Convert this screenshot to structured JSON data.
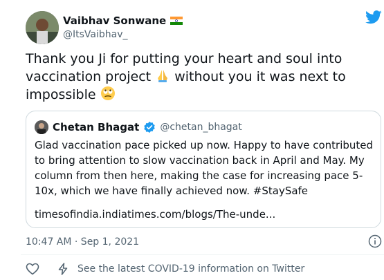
{
  "tweet": {
    "author_name": "Vaibhav Sonwane",
    "author_handle": "@ItsVaibhav_",
    "text_part1": "Thank you Ji for putting your heart and soul into vaccination project",
    "text_part2": " without you it was next to impossible",
    "timestamp": "10:47 AM · Sep 1, 2021",
    "covid_link": "See the latest COVID-19 information on Twitter"
  },
  "quoted": {
    "author_name": "Chetan Bhagat",
    "author_handle": "@chetan_bhagat",
    "text": "Glad vaccination pace picked up now. Happy to have contributed to bring attention to slow vaccination back in April and May. My column from then here, making the case for increasing pace 5-10x, which we have finally achieved now. #StaySafe",
    "link": "timesofindia.indiatimes.com/blogs/The-unde..."
  },
  "icons": {
    "twitter_logo": "twitter-bird-icon",
    "flag": "india-flag-icon",
    "verified": "verified-badge-icon",
    "info": "info-icon",
    "like": "heart-icon",
    "activity": "bolt-icon"
  },
  "colors": {
    "brand_blue": "#1d9bf0",
    "text": "#0f1419",
    "secondary": "#536471",
    "border": "#cfd9de"
  }
}
